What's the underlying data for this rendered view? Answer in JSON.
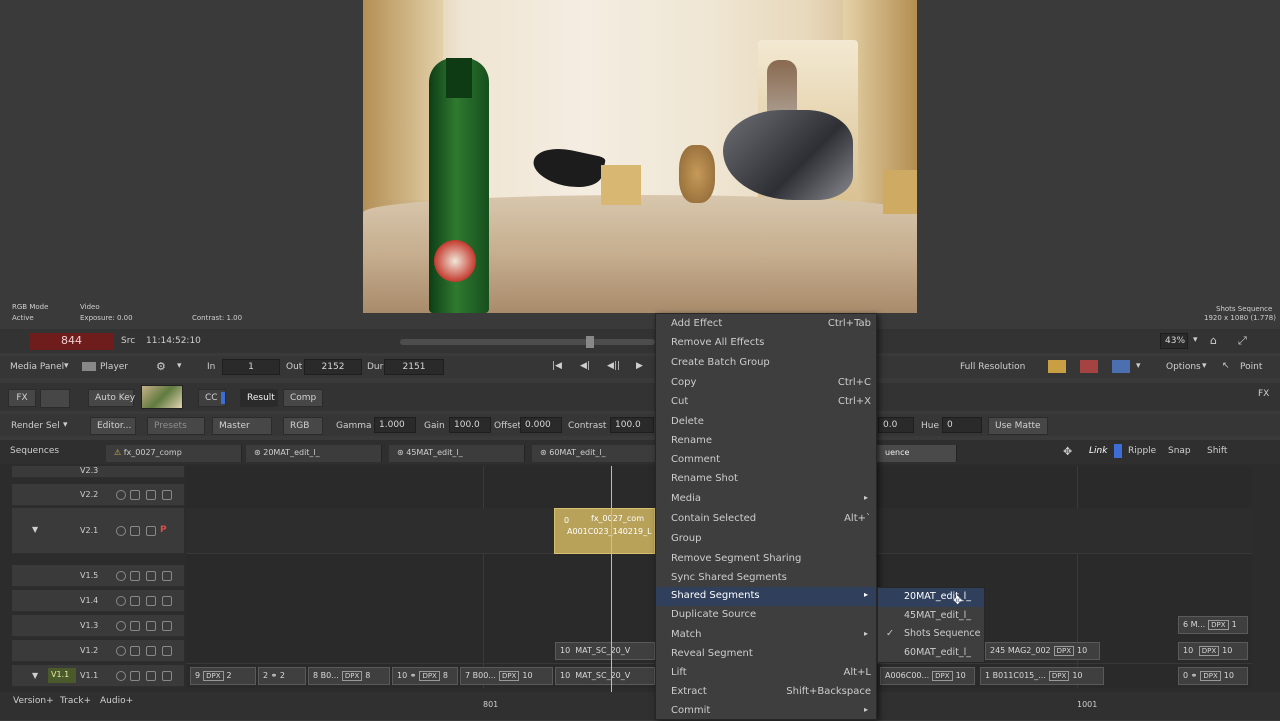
{
  "viewer": {
    "rgb_mode_label": "RGB Mode",
    "rgb_mode_value": "Active",
    "video_label": "Video",
    "exposure": "Exposure: 0.00",
    "contrast": "Contrast: 1.00",
    "sequence_title": "Shots Sequence",
    "resolution": "1920 x 1080 (1.778)"
  },
  "transport": {
    "frame": "844",
    "src_label": "Src",
    "timecode": "11:14:52:10",
    "zoom": "43%"
  },
  "player_bar": {
    "media_panel": "Media Panel",
    "player": "Player",
    "in_label": "In",
    "in_value": "1",
    "out_label": "Out",
    "out_value": "2152",
    "dur_label": "Dur",
    "dur_value": "2151",
    "full_resolution": "Full Resolution",
    "options": "Options",
    "point": "Point"
  },
  "fx_bar": {
    "fx": "FX",
    "auto_key": "Auto Key",
    "cc": "CC",
    "result": "Result",
    "comp": "Comp",
    "fx_right": "FX"
  },
  "cc_bar": {
    "render_sel": "Render Sel",
    "editor": "Editor...",
    "presets": "Presets",
    "master": "Master",
    "rgb": "RGB",
    "gamma_label": "Gamma",
    "gamma_value": "1.000",
    "gain_label": "Gain",
    "gain_value": "100.0",
    "offset_label": "Offset",
    "offset_value": "0.000",
    "contrast_label": "Contrast",
    "contrast_value": "100.0",
    "sat_value": "0.0",
    "hue_label": "Hue",
    "hue_value": "0",
    "use_matte": "Use Matte"
  },
  "sequence_tabs": {
    "sequences_label": "Sequences",
    "tabs": [
      "fx_0027_comp",
      "20MAT_edit_l_",
      "45MAT_edit_l_",
      "60MAT_edit_l_"
    ],
    "active_tab_suffix": "uence",
    "link": "Link",
    "ripple": "Ripple",
    "snap": "Snap",
    "shift": "Shift"
  },
  "tracks": [
    "V2.3",
    "V2.2",
    "V2.1",
    "V1.5",
    "V1.4",
    "V1.3",
    "V1.2",
    "V1.1"
  ],
  "track_v11_left": "V1.1",
  "priority_badge": "P",
  "segments": {
    "fx_seg_top": "fx_0027_com",
    "fx_seg_bottom": "A001C023_140219_L",
    "fx_seg_num": "0",
    "v12_left_num": "10",
    "v12_left_name": "MAT_SC_20_V",
    "v12_right_num": "245",
    "v12_right_name": "MAG2_002",
    "v12_right_dpx": "DPX",
    "v12_right_end": "10",
    "v12_far_num": "10",
    "v12_far_dpx": "DPX",
    "v12_far_end": "10",
    "v13_far_num": "6",
    "v13_far_name": "M...",
    "v13_far_dpx": "DPX",
    "v13_far_end": "1",
    "v11": [
      {
        "a": "9",
        "dpx": "DPX",
        "b": "2"
      },
      {
        "a": "2",
        "name": "",
        "b": "2"
      },
      {
        "a": "8",
        "name": "B0...",
        "dpx": "DPX",
        "b": "8"
      },
      {
        "a": "10",
        "dpx": "DPX",
        "b": "8"
      },
      {
        "a": "7",
        "name": "B00...",
        "dpx": "DPX",
        "b": "10"
      },
      {
        "a": "10",
        "name": "MAT_SC_20_V",
        "b": ""
      },
      {
        "a": "",
        "name": "A006C00...",
        "dpx": "DPX",
        "b": "10"
      },
      {
        "a": "1",
        "name": "B011C015_...",
        "dpx": "DPX",
        "b": "10"
      },
      {
        "a": "0",
        "dpx": "DPX",
        "b": "10"
      }
    ]
  },
  "ruler": {
    "mark_left": "801",
    "mark_right": "1001"
  },
  "bottom_bar": {
    "version": "Version+",
    "track": "Track+",
    "audio": "Audio+"
  },
  "context_menu": {
    "items": [
      {
        "label": "Add Effect",
        "shortcut": "Ctrl+Tab"
      },
      {
        "label": "Remove All Effects",
        "shortcut": ""
      },
      {
        "label": "Create Batch Group",
        "shortcut": ""
      },
      {
        "label": "Copy",
        "shortcut": "Ctrl+C"
      },
      {
        "label": "Cut",
        "shortcut": "Ctrl+X"
      },
      {
        "label": "Delete",
        "shortcut": ""
      },
      {
        "label": "Rename",
        "shortcut": ""
      },
      {
        "label": "Comment",
        "shortcut": ""
      },
      {
        "label": "Rename Shot",
        "shortcut": ""
      },
      {
        "label": "Media",
        "shortcut": ""
      },
      {
        "label": "Contain Selected",
        "shortcut": "Alt+`"
      },
      {
        "label": "Group",
        "shortcut": ""
      },
      {
        "label": "Remove Segment Sharing",
        "shortcut": ""
      },
      {
        "label": "Sync Shared Segments",
        "shortcut": ""
      },
      {
        "label": "Shared Segments",
        "shortcut": ""
      },
      {
        "label": "Duplicate Source",
        "shortcut": ""
      },
      {
        "label": "Match",
        "shortcut": ""
      },
      {
        "label": "Reveal Segment",
        "shortcut": ""
      },
      {
        "label": "Lift",
        "shortcut": "Alt+L"
      },
      {
        "label": "Extract",
        "shortcut": "Shift+Backspace"
      },
      {
        "label": "Commit",
        "shortcut": ""
      }
    ]
  },
  "submenu": {
    "items": [
      "20MAT_edit_l_",
      "45MAT_edit_l_",
      "Shots Sequence",
      "60MAT_edit_l_"
    ],
    "checked": "Shots Sequence"
  },
  "colors": {
    "accent": "#2f3f5c",
    "frame_badge": "#7a1f1f",
    "fx_segment": "#b8a25a",
    "playhead": "#d9c060"
  }
}
